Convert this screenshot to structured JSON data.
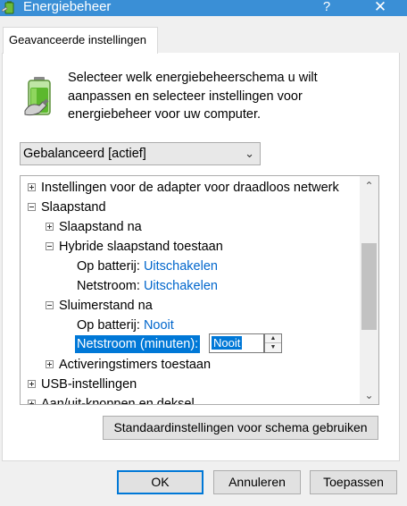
{
  "window": {
    "title": "Energiebeheer",
    "help_glyph": "?",
    "close_glyph": "✕"
  },
  "tab": {
    "label": "Geavanceerde instellingen"
  },
  "description": "Selecteer welk energiebeheerschema u wilt aanpassen en selecteer instellingen voor energiebeheer voor uw computer.",
  "plan_select": {
    "value": "Gebalanceerd [actief]"
  },
  "tree": {
    "items": [
      {
        "label": "Instellingen voor de adapter voor draadloos netwerk",
        "expander": "plus"
      },
      {
        "label": "Slaapstand",
        "expander": "minus"
      },
      {
        "label": "Slaapstand na",
        "expander": "plus"
      },
      {
        "label": "Hybride slaapstand toestaan",
        "expander": "minus"
      },
      {
        "label": "Op batterij:",
        "value": "Uitschakelen"
      },
      {
        "label": "Netstroom:",
        "value": "Uitschakelen"
      },
      {
        "label": "Sluimerstand na",
        "expander": "minus"
      },
      {
        "label": "Op batterij:",
        "value": "Nooit"
      },
      {
        "label": "Netstroom (minuten):",
        "value": "Nooit"
      },
      {
        "label": "Activeringstimers toestaan",
        "expander": "plus"
      },
      {
        "label": "USB-instellingen",
        "expander": "plus"
      },
      {
        "label": "Aan/uit-knoppen en deksel",
        "expander": "plus"
      }
    ]
  },
  "buttons": {
    "restore_defaults": "Standaardinstellingen voor schema gebruiken",
    "ok": "OK",
    "cancel": "Annuleren",
    "apply": "Toepassen"
  },
  "colors": {
    "titlebar": "#3a8fd6",
    "link": "#0066cc",
    "selection": "#0078d7"
  }
}
